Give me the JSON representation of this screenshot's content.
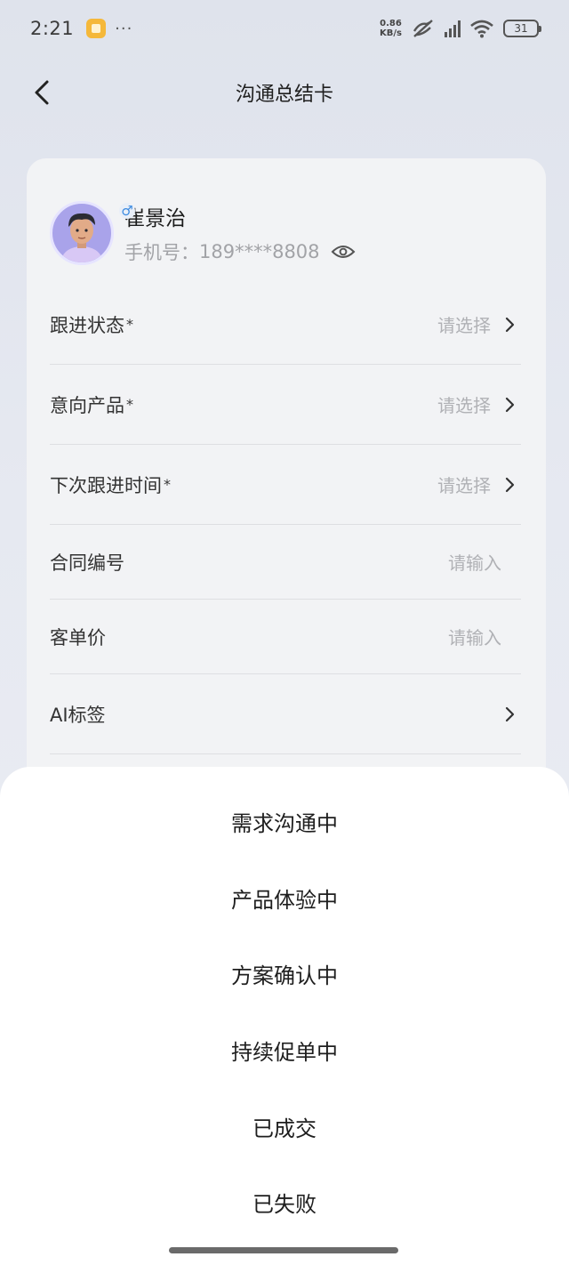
{
  "status_bar": {
    "time": "2:21",
    "dots": "···",
    "net_speed_value": "0.86",
    "net_speed_unit": "KB/s",
    "battery": "31"
  },
  "header": {
    "title": "沟通总结卡"
  },
  "profile": {
    "name": "崔景治",
    "gender_symbol": "♂",
    "phone_label": "手机号：",
    "phone_value": "189****8808"
  },
  "form": {
    "rows": [
      {
        "label": "跟进状态",
        "required": "*",
        "value": "请选择"
      },
      {
        "label": "意向产品",
        "required": "*",
        "value": "请选择"
      },
      {
        "label": "下次跟进时间",
        "required": "*",
        "value": "请选择"
      },
      {
        "label": "合同编号",
        "value": "请输入"
      },
      {
        "label": "客单价",
        "value": "请输入"
      },
      {
        "label": "AI标签",
        "value": ""
      }
    ]
  },
  "sheet": {
    "options": [
      "需求沟通中",
      "产品体验中",
      "方案确认中",
      "持续促单中",
      "已成交",
      "已失败"
    ]
  }
}
